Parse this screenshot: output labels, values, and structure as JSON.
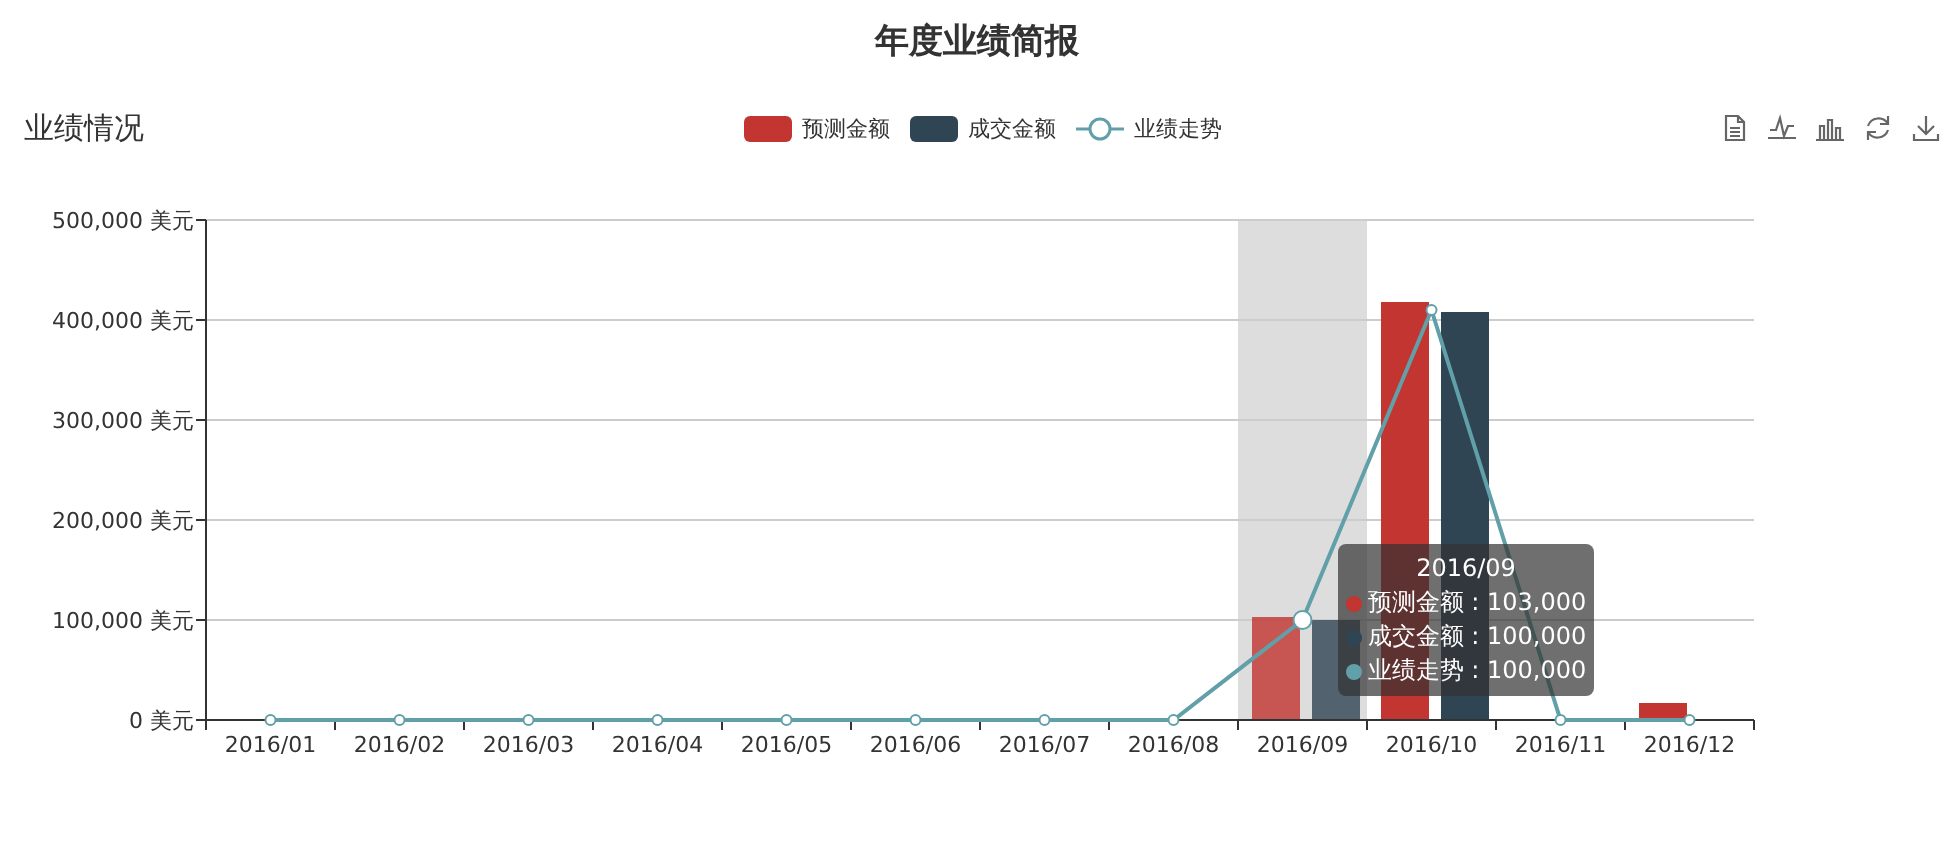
{
  "title": "年度业绩简报",
  "panel": {
    "title": "业绩情况",
    "chart_data": {
      "type": "bar",
      "categories": [
        "2016/01",
        "2016/02",
        "2016/03",
        "2016/04",
        "2016/05",
        "2016/06",
        "2016/07",
        "2016/08",
        "2016/09",
        "2016/10",
        "2016/11",
        "2016/12"
      ],
      "ylim": [
        0,
        500000
      ],
      "grid": true,
      "bands": [
        {
          "axis": "x",
          "from": "2016/09",
          "to": "2016/09",
          "color": "#dddddd"
        }
      ],
      "yticks": [
        {
          "value": 0,
          "label": "0 美元"
        },
        {
          "value": 100000,
          "label": "100,000 美元"
        },
        {
          "value": 200000,
          "label": "200,000 美元"
        },
        {
          "value": 300000,
          "label": "300,000 美元"
        },
        {
          "value": 400000,
          "label": "400,000 美元"
        },
        {
          "value": 500000,
          "label": "500,000 美元"
        }
      ],
      "series": [
        {
          "name": "预测金额",
          "type": "bar",
          "color": "#c23531",
          "values": [
            0,
            0,
            0,
            0,
            0,
            0,
            0,
            0,
            103000,
            418000,
            0,
            17000
          ]
        },
        {
          "name": "成交金额",
          "type": "bar",
          "color": "#2f4554",
          "values": [
            0,
            0,
            0,
            0,
            0,
            0,
            0,
            0,
            100000,
            408000,
            0,
            0
          ]
        },
        {
          "name": "业绩走势",
          "type": "line",
          "marker": "circle",
          "color": "#61a0a8",
          "values": [
            0,
            0,
            0,
            0,
            0,
            0,
            0,
            0,
            100000,
            410000,
            0,
            0
          ]
        }
      ]
    },
    "tooltip": {
      "title": "2016/09",
      "rows": [
        {
          "text": "预测金额 : 103,000",
          "color": "#c23531"
        },
        {
          "text": "成交金额 : 100,000",
          "color": "#2f4554"
        },
        {
          "text": "业绩走势 : 100,000",
          "color": "#61a0a8"
        }
      ]
    }
  }
}
